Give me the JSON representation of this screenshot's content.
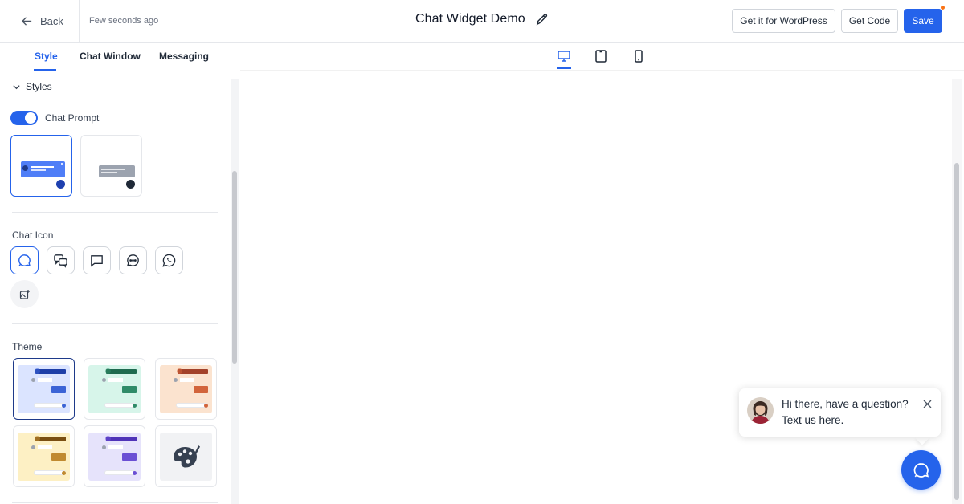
{
  "header": {
    "back_label": "Back",
    "saved_status": "Few seconds ago",
    "title": "Chat Widget Demo",
    "wordpress_button": "Get it for WordPress",
    "get_code_button": "Get Code",
    "save_button": "Save"
  },
  "tabs": [
    {
      "label": "Style",
      "active": true
    },
    {
      "label": "Chat Window",
      "active": false
    },
    {
      "label": "Messaging",
      "active": false
    }
  ],
  "styles_section": {
    "title": "Styles",
    "chat_prompt_label": "Chat Prompt",
    "chat_prompt_enabled": true,
    "prompt_layouts": [
      "bubble-left-dot",
      "bar-right-dot"
    ],
    "selected_layout": 0
  },
  "chat_icon_section": {
    "label": "Chat Icon",
    "icons": [
      "chat-bubble-icon",
      "double-chat-icon",
      "square-chat-icon",
      "dots-chat-icon",
      "whatsapp-icon",
      "upload-image-icon"
    ],
    "selected": 0
  },
  "theme_section": {
    "label": "Theme",
    "themes": [
      {
        "name": "blue",
        "accent": "#1e3fa8",
        "bg": "#dbe4ff",
        "bubble": "#3b63d6"
      },
      {
        "name": "green",
        "accent": "#1f6b4f",
        "bg": "#d7f5ea",
        "bubble": "#2f8b68"
      },
      {
        "name": "orange",
        "accent": "#a3422a",
        "bg": "#fbe3cf",
        "bubble": "#d2643b"
      },
      {
        "name": "yellow",
        "accent": "#7a4f12",
        "bg": "#fdf0c4",
        "bubble": "#c08a30"
      },
      {
        "name": "purple",
        "accent": "#4f33b8",
        "bg": "#e6e3fb",
        "bubble": "#6a4fd4"
      },
      {
        "name": "custom",
        "icon": "palette-icon"
      }
    ],
    "selected": 0
  },
  "device_bar": {
    "devices": [
      "desktop-icon",
      "tablet-icon",
      "mobile-icon"
    ],
    "active": "desktop-icon"
  },
  "preview": {
    "prompt_text": "Hi there, have a question? Text us here.",
    "accent": "#2563eb"
  }
}
